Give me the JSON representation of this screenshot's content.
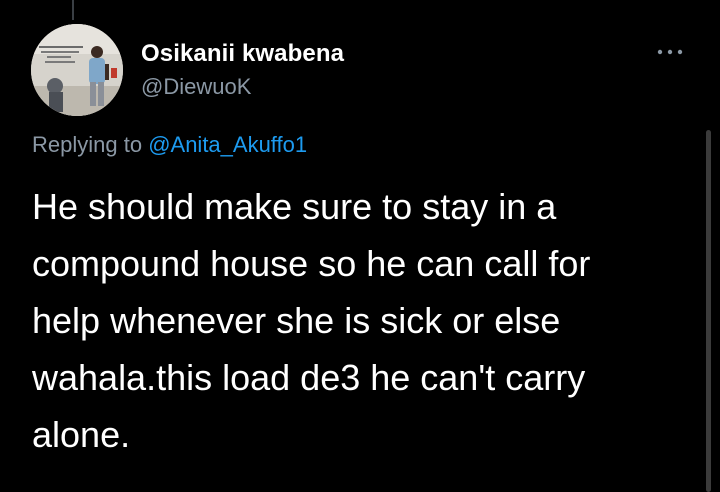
{
  "user": {
    "display_name": "Osikanii kwabena",
    "handle": "@DiewuoK",
    "avatar_icon": "profile-photo"
  },
  "reply": {
    "prefix": "Replying to ",
    "mention": "@Anita_Akuffo1"
  },
  "tweet": {
    "lines": [
      "He should make sure to stay in a",
      "compound house so he can call for",
      "help whenever she is sick or else",
      "wahala.this load de3 he can't carry",
      "alone."
    ]
  },
  "colors": {
    "background": "#000000",
    "text": "#ffffff",
    "secondary": "#8b98a5",
    "accent": "#1d9bf0"
  },
  "icons": {
    "more": "more-horizontal-icon"
  }
}
